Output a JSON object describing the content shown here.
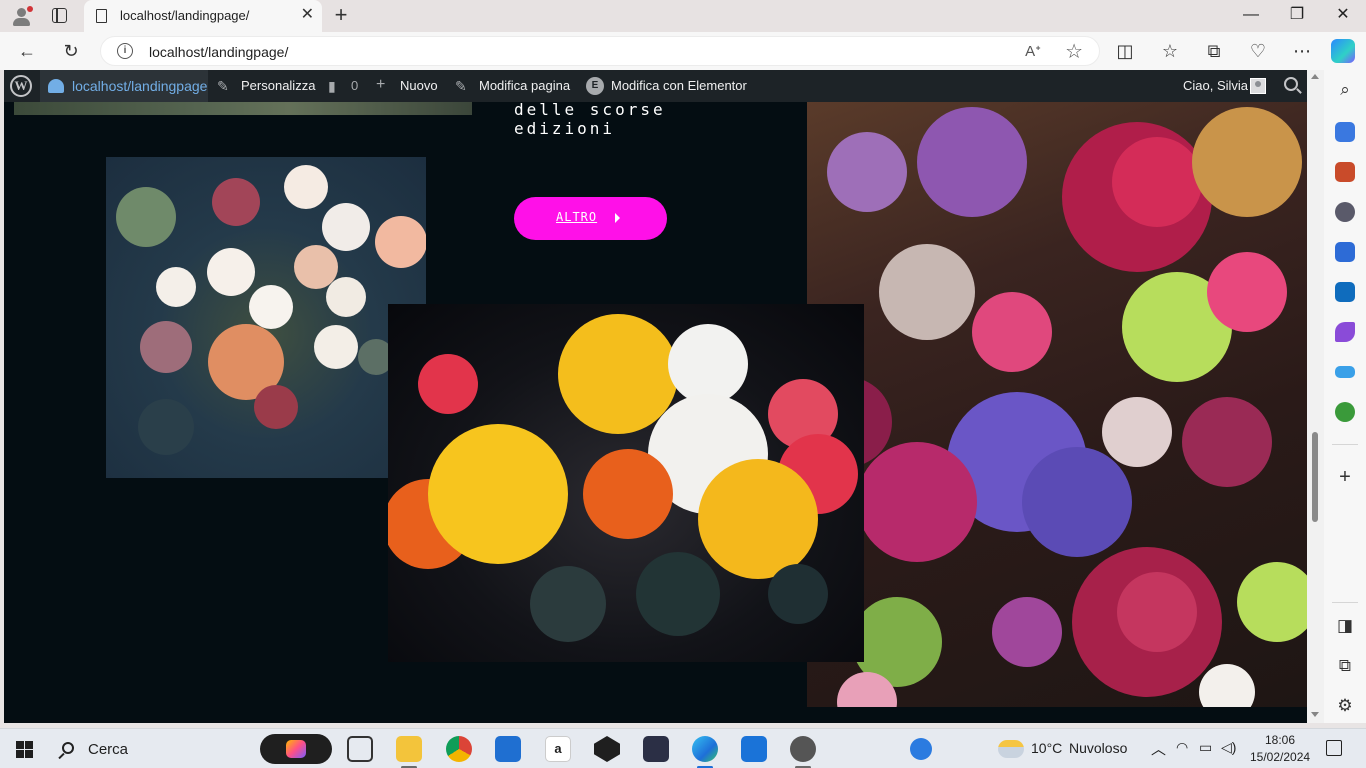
{
  "browser": {
    "tab_title": "localhost/landingpage/",
    "tab_close": "✕",
    "new_tab": "+",
    "url": "localhost/landingpage/",
    "window_controls": [
      "—",
      "❐",
      "✕"
    ]
  },
  "admin_bar": {
    "site_name": "localhost/landingpage",
    "customize": "Personalizza",
    "comments_count": "0",
    "new": "Nuovo",
    "edit_page": "Modifica pagina",
    "edit_elementor": "Modifica con Elementor",
    "greeting": "Ciao, Silvia"
  },
  "page": {
    "text_lines": [
      "delle scorse",
      "edizioni"
    ],
    "button_label": "ALTRO",
    "images": [
      {
        "name": "bouquet-left",
        "colors": [
          "#f5ebe3",
          "#f2b9a0",
          "#9a3b4a",
          "#6f7f6a"
        ]
      },
      {
        "name": "bouquet-right",
        "colors": [
          "#b01e4a",
          "#7a4bb8",
          "#c5e06a",
          "#e8487d"
        ]
      },
      {
        "name": "bouquet-center",
        "colors": [
          "#f7c51e",
          "#f2f2f0",
          "#e8601c",
          "#e2344b"
        ]
      }
    ]
  },
  "taskbar": {
    "search_label": "Cerca",
    "weather_temp": "10°C",
    "weather_desc": "Nuvoloso",
    "time": "18:06",
    "date": "15/02/2024"
  },
  "colors": {
    "page_bg": "#040d12",
    "accent_pink": "#ff10e8",
    "admin_bar_bg": "#1d2327",
    "admin_link": "#72aee6"
  }
}
